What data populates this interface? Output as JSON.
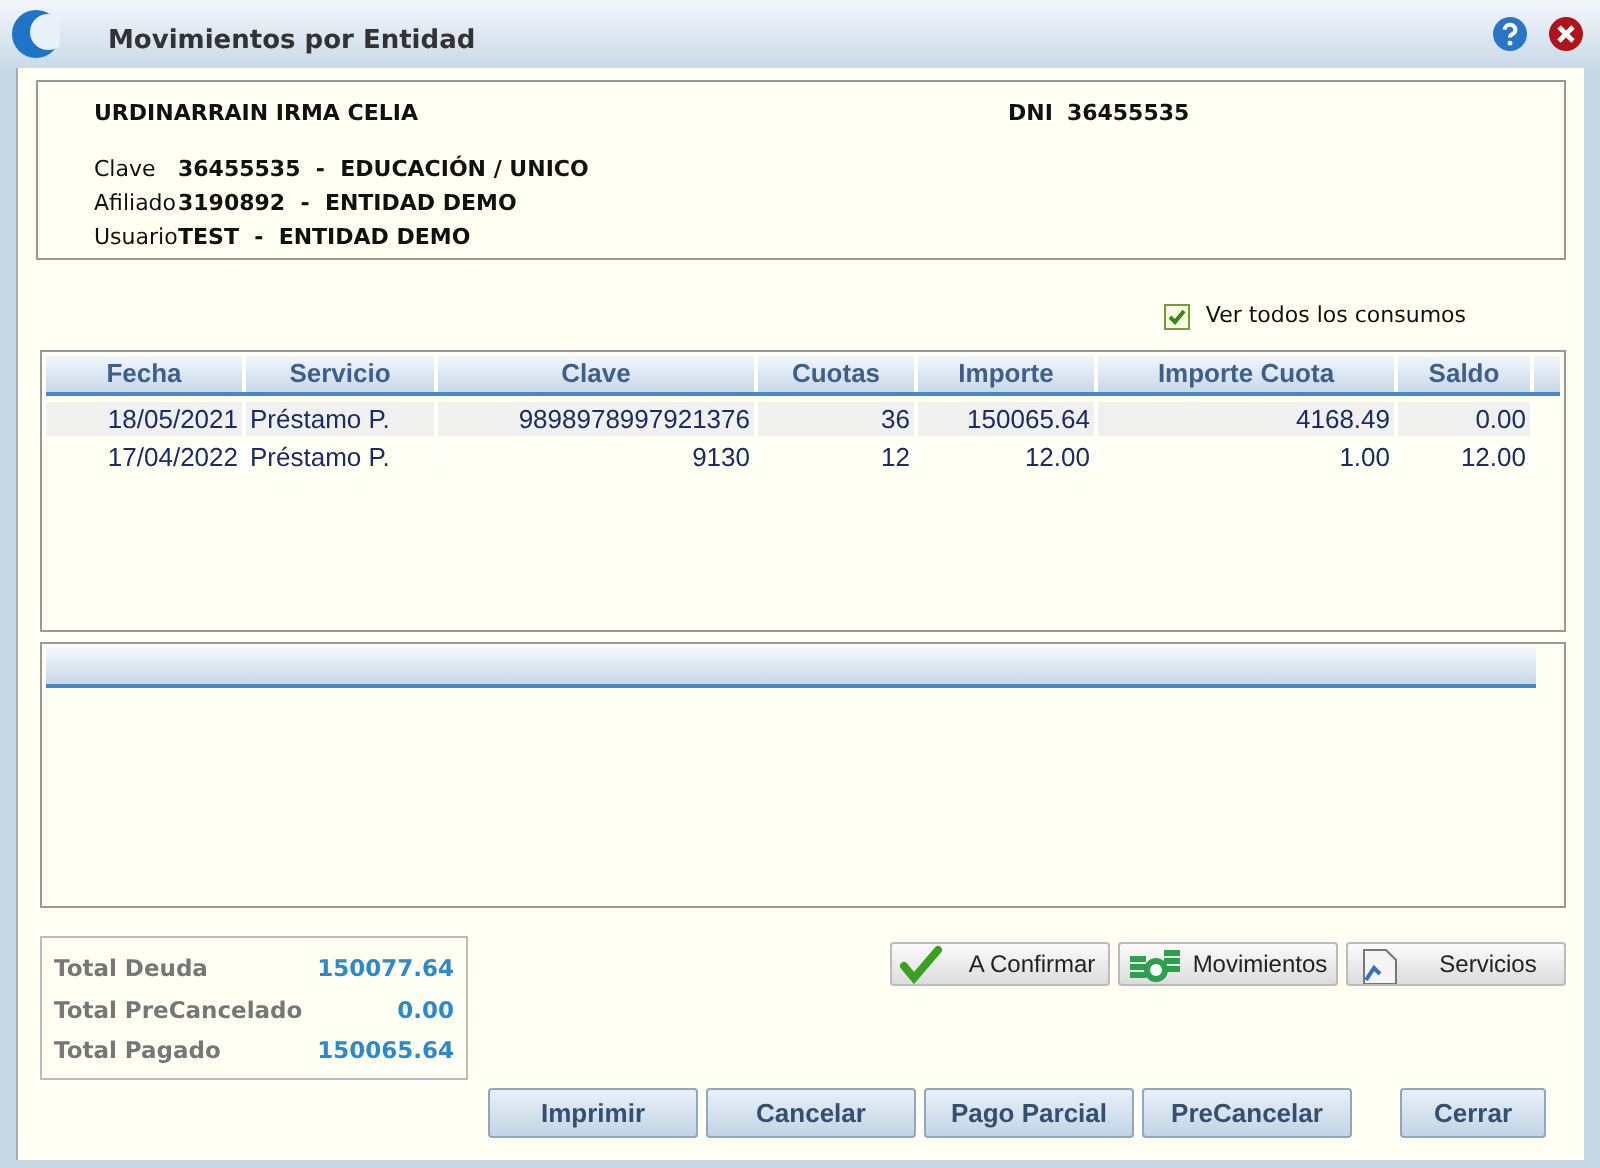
{
  "window": {
    "title": "Movimientos por Entidad"
  },
  "info": {
    "name": "URDINARRAIN IRMA CELIA",
    "dni_label": "DNI",
    "dni": "36455535",
    "fields": [
      {
        "label": "Clave",
        "value": "36455535  -  EDUCACIÓN / UNICO"
      },
      {
        "label": "Afiliado",
        "value": "3190892  -  ENTIDAD DEMO"
      },
      {
        "label": "Usuario",
        "value": "TEST  -  ENTIDAD DEMO"
      }
    ]
  },
  "show_all": {
    "label": "Ver todos los consumos",
    "checked": true
  },
  "table": {
    "columns": [
      "Fecha",
      "Servicio",
      "Clave",
      "Cuotas",
      "Importe",
      "Importe Cuota",
      "Saldo"
    ],
    "rows": [
      [
        "18/05/2021",
        "Préstamo P.",
        "9898978997921376",
        "36",
        "150065.64",
        "4168.49",
        "0.00"
      ],
      [
        "17/04/2022",
        "Préstamo P.",
        "9130",
        "12",
        "12.00",
        "1.00",
        "12.00"
      ]
    ]
  },
  "totals": [
    {
      "label": "Total Deuda",
      "value": "150077.64"
    },
    {
      "label": "Total PreCancelado",
      "value": "0.00"
    },
    {
      "label": "Total Pagado",
      "value": "150065.64"
    }
  ],
  "action_buttons": [
    {
      "label": "A Confirmar",
      "kind": "check"
    },
    {
      "label": "Movimientos",
      "kind": "coins"
    },
    {
      "label": "Servicios",
      "kind": "document"
    }
  ],
  "bottom_buttons": [
    "Imprimir",
    "Cancelar",
    "Pago Parcial",
    "PreCancelar",
    "Cerrar"
  ]
}
